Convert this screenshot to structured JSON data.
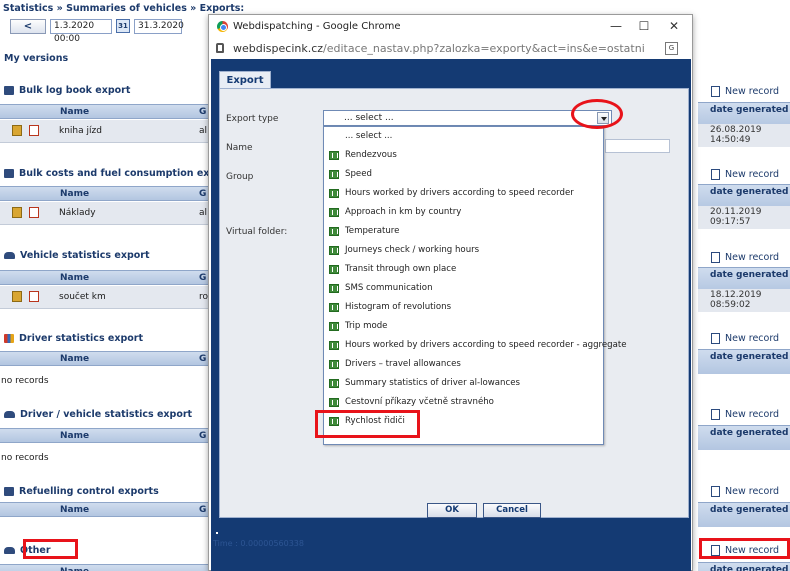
{
  "breadcrumb": "Statistics » Summaries of vehicles » Exports:",
  "daterow": {
    "back_label": "<",
    "from": "1.3.2020 00:00",
    "cal_label": "31",
    "to": "31.3.2020"
  },
  "my_versions": "My versions",
  "table_headers": {
    "name": "Name",
    "group": "G",
    "date": "date generated"
  },
  "new_record": "New record",
  "sections": [
    {
      "title": "Bulk log book export",
      "row": {
        "name": "kniha jízd",
        "group": "al",
        "date": "26.08.2019 14:50:49"
      }
    },
    {
      "title": "Bulk costs and fuel consumption export",
      "row": {
        "name": "Náklady",
        "group": "al",
        "date": "20.11.2019 09:17:57"
      }
    },
    {
      "title": "Vehicle statistics export",
      "row": {
        "name": "součet km",
        "group": "ro",
        "date": "18.12.2019 08:59:02"
      }
    },
    {
      "title": "Driver statistics export",
      "norecords": "no records"
    },
    {
      "title": "Driver / vehicle statistics export",
      "norecords": "no records"
    },
    {
      "title": "Refuelling control exports"
    },
    {
      "title": "Other"
    }
  ],
  "popup": {
    "window_title": "Webdispatching - Google Chrome",
    "url_host": "webdispecink.cz",
    "url_path": "/editace_nastav.php?zalozka=exporty&act=ins&e=ostatni",
    "tab": "Export",
    "labels": {
      "export_type": "Export type",
      "name": "Name",
      "group": "Group",
      "virtual_folder": "Virtual folder:"
    },
    "select_value": "... select ...",
    "options": [
      "... select ...",
      "Rendezvous",
      "Speed",
      "Hours worked by drivers according to speed recorder",
      "Approach in km by country",
      "Temperature",
      "Journeys check / working hours",
      "Transit through own place",
      "SMS communication",
      "Histogram of revolutions",
      "Trip mode",
      "Hours worked by drivers according to speed recorder - aggregate",
      "Drivers – travel allowances",
      "Summary statistics of driver al-lowances",
      "Cestovní příkazy včetně stravného",
      "Rychlost řidiči"
    ],
    "ok": "OK",
    "cancel": "Cancel",
    "footer": "Time : 0.00000560338"
  },
  "colors": {
    "accent": "#143a73",
    "highlight": "#e8131a"
  }
}
